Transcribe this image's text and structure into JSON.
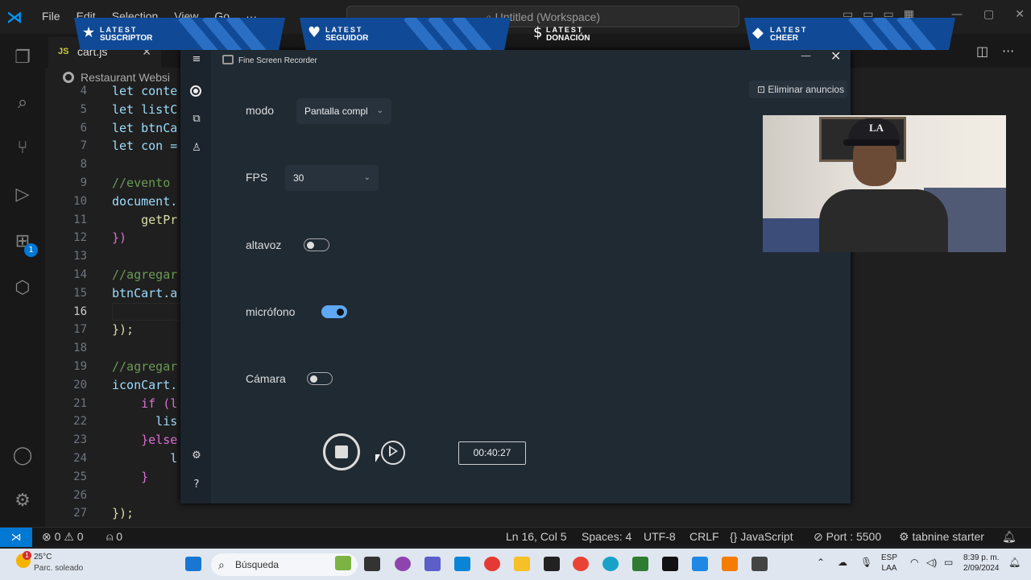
{
  "vscode": {
    "menu": [
      "File",
      "Edit",
      "Selection",
      "View",
      "Go",
      "···"
    ],
    "command_center": "Untitled (Workspace)",
    "tab": {
      "icon_label": "JS",
      "label": "cart.js"
    },
    "breadcrumb": "Restaurant Websi",
    "line_numbers": [
      "4",
      "5",
      "6",
      "7",
      "8",
      "9",
      "10",
      "11",
      "12",
      "13",
      "14",
      "15",
      "16",
      "17",
      "18",
      "19",
      "20",
      "21",
      "22",
      "23",
      "24",
      "25",
      "26",
      "27"
    ],
    "current_line": "16",
    "code_lines": [
      "let conte",
      "let listC",
      "let btnCa",
      "let con =",
      "",
      "//evento",
      "document.",
      "    getPr",
      "})",
      "",
      "//agregar",
      "btnCart.a",
      "",
      "});",
      "",
      "//agregar",
      "iconCart.",
      "    if (l",
      "      lis",
      "    }else",
      "        l",
      "    }",
      "",
      "});"
    ],
    "extensions_badge": "1",
    "status": {
      "errors": "0",
      "warnings": "0",
      "ports_count": "0",
      "position": "Ln 16, Col 5",
      "spaces": "Spaces: 4",
      "encoding": "UTF-8",
      "eol": "CRLF",
      "language": "JavaScript",
      "port": "Port : 5500",
      "tabnine": "tabnine starter"
    }
  },
  "recorder": {
    "title": "Fine Screen Recorder",
    "remove_ads": "Eliminar anuncios",
    "mode_label": "modo",
    "mode_value": "Pantalla compl",
    "fps_label": "FPS",
    "fps_value": "30",
    "speaker_label": "altavoz",
    "speaker_on": false,
    "mic_label": "micrófono",
    "mic_on": true,
    "camera_label": "Cámara",
    "camera_on": false,
    "timer": "00:40:27"
  },
  "stream_alerts": [
    {
      "line1": "LATEST",
      "line2": "SUSCRIPTOR",
      "icon": "star-icon"
    },
    {
      "line1": "LATEST",
      "line2": "SEGUIDOR",
      "icon": "heart-icon"
    },
    {
      "line1": "LATEST",
      "line2": "DONACIÓN",
      "icon": "dollar-icon"
    },
    {
      "line1": "LATEST",
      "line2": "CHEER",
      "icon": "diamond-icon"
    }
  ],
  "taskbar": {
    "weather_temp": "25°C",
    "weather_desc": "Parc. soleado",
    "weather_badge": "1",
    "search_placeholder": "Búsqueda",
    "lang1": "ESP",
    "lang2": "LAA",
    "time": "8:39 p. m.",
    "date": "2/09/2024"
  },
  "colors": {
    "accent": "#0078d4",
    "recorder_bg": "#202a33",
    "toggle_on": "#5fa8f5",
    "alert_blue": "#104a96"
  }
}
